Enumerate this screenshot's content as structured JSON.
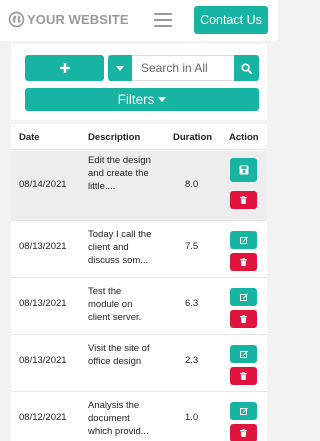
{
  "header": {
    "logo_text": "YOUR WEBSITE",
    "logo_icon": "globe-icon",
    "menu_icon": "hamburger-icon",
    "contact_label": "Contact Us"
  },
  "toolbar": {
    "add_icon": "plus-icon",
    "dropdown_icon": "caret-down-icon",
    "search_placeholder": "Search in All",
    "search_value": "",
    "search_icon": "magnifier-icon",
    "filters_label": "Filters",
    "filters_icon": "caret-down-icon"
  },
  "table": {
    "columns": [
      "Date",
      "Description",
      "Duration",
      "Action"
    ],
    "rows": [
      {
        "date": "08/14/2021",
        "description": "Edit the design and create the little....",
        "duration": "8.0",
        "primary_action_icon": "save-icon",
        "delete_icon": "trash-icon"
      },
      {
        "date": "08/13/2021",
        "description": "Today I call the client and discuss som...",
        "duration": "7.5",
        "primary_action_icon": "edit-icon",
        "delete_icon": "trash-icon"
      },
      {
        "date": "08/13/2021",
        "description": "Test the module on client server.",
        "duration": "6.3",
        "primary_action_icon": "edit-icon",
        "delete_icon": "trash-icon"
      },
      {
        "date": "08/13/2021",
        "description": "Visit the site of office design",
        "duration": "2.3",
        "primary_action_icon": "edit-icon",
        "delete_icon": "trash-icon"
      },
      {
        "date": "08/12/2021",
        "description": "Analysis the document which provid...",
        "duration": "1.0",
        "primary_action_icon": "edit-icon",
        "delete_icon": "trash-icon"
      }
    ]
  },
  "colors": {
    "accent": "#17b3a3",
    "danger": "#e0143c",
    "logo_gray": "#9a9a9a"
  }
}
